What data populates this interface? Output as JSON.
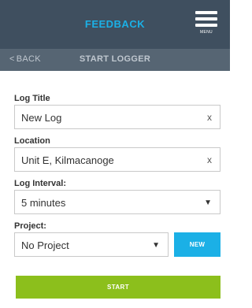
{
  "header": {
    "title": "FEEDBACK",
    "menu_label": "MENU",
    "menu_icon": "hamburger-menu-icon",
    "accent_color": "#1bb0e6",
    "bar_color": "#3f4f5f"
  },
  "subheader": {
    "back_label": "BACK",
    "back_icon": "chevron-left-icon",
    "title": "START LOGGER",
    "bar_color": "#566573"
  },
  "form": {
    "log_title": {
      "label": "Log Title",
      "value": "New Log",
      "clear_glyph": "x"
    },
    "location": {
      "label": "Location",
      "value": "Unit E, Kilmacanoge",
      "clear_glyph": "x"
    },
    "log_interval": {
      "label": "Log Interval:",
      "value": "5 minutes",
      "arrow_glyph": "▼"
    },
    "project": {
      "label": "Project:",
      "value": "No Project",
      "arrow_glyph": "▼",
      "new_label": "NEW"
    }
  },
  "actions": {
    "start_label": "START",
    "start_color": "#8cbf1c"
  }
}
